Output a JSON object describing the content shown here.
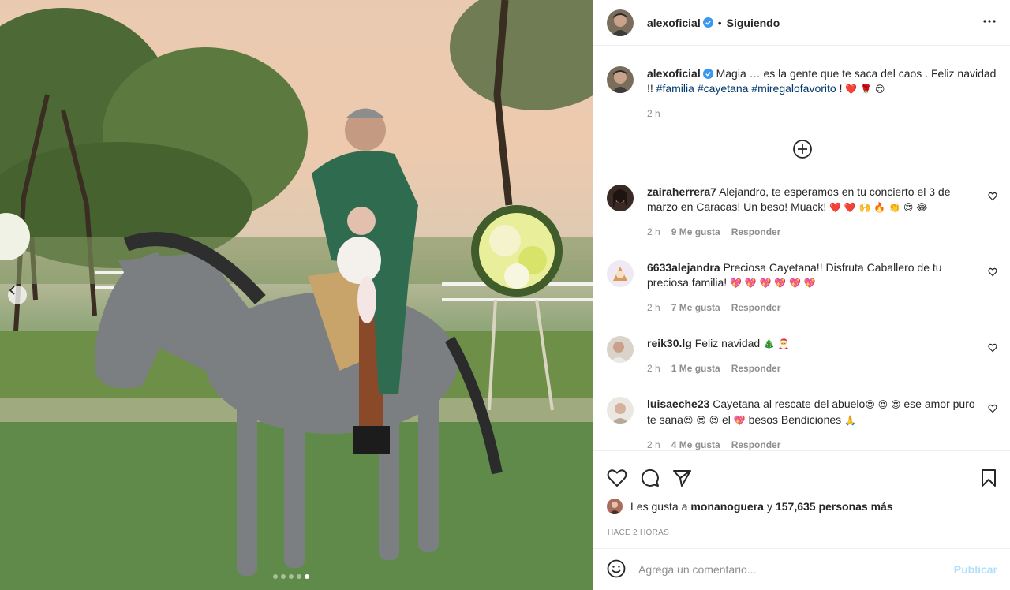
{
  "post": {
    "username": "alexoficial",
    "follow_label": "Siguiendo",
    "separator": "•",
    "caption_text": "Magia … es la gente que te saca del caos . Feliz navidad !!",
    "hashtags": [
      "#familia",
      "#cayetana",
      "#miregalofavorito"
    ],
    "caption_tail": "!",
    "caption_emojis": "❤️ 🌹 😍",
    "caption_time": "2 h",
    "carousel": {
      "count": 5,
      "active": 5
    }
  },
  "comments": [
    {
      "username": "zairaherrera7",
      "text": "Alejandro, te esperamos en tu concierto el 3 de marzo en Caracas! Un beso! Muack!",
      "emojis": "❤️ ❤️ 🙌 🔥 👏 😍 😂",
      "time": "2 h",
      "likes": "9 Me gusta",
      "reply": "Responder"
    },
    {
      "username": "6633alejandra",
      "text": "Preciosa Cayetana!! Disfruta Caballero de tu preciosa familia!",
      "emojis": "💖 💖 💖 💖 💖 💖",
      "time": "2 h",
      "likes": "7 Me gusta",
      "reply": "Responder"
    },
    {
      "username": "reik30.lg",
      "text": "Feliz navidad",
      "emojis": "🎄 🎅",
      "time": "2 h",
      "likes": "1 Me gusta",
      "reply": "Responder"
    },
    {
      "username": "luisaeche23",
      "text_a": "Cayetana al rescate del abuelo",
      "emojis_a": "😍 😍 😍",
      "text_b": "ese amor puro te sana",
      "emojis_b": "😍 😍 😍",
      "text_c": "el",
      "emojis_c": "💖",
      "text_d": "besos Bendiciones",
      "emojis_d": "🙏",
      "time": "2 h",
      "likes": "4 Me gusta",
      "reply": "Responder"
    }
  ],
  "likes": {
    "prefix": "Les gusta a",
    "user": "monanoguera",
    "middle": "y",
    "count_text": "157,635 personas más"
  },
  "timestamp": "HACE 2 HORAS",
  "add_comment": {
    "placeholder": "Agrega un comentario...",
    "publish": "Publicar"
  },
  "colors": {
    "accent_blue": "#0095f6",
    "publish_disabled": "#b2dffc",
    "hashtag": "#00376b",
    "muted": "#8e8e8e",
    "verified": "#3897f0"
  }
}
